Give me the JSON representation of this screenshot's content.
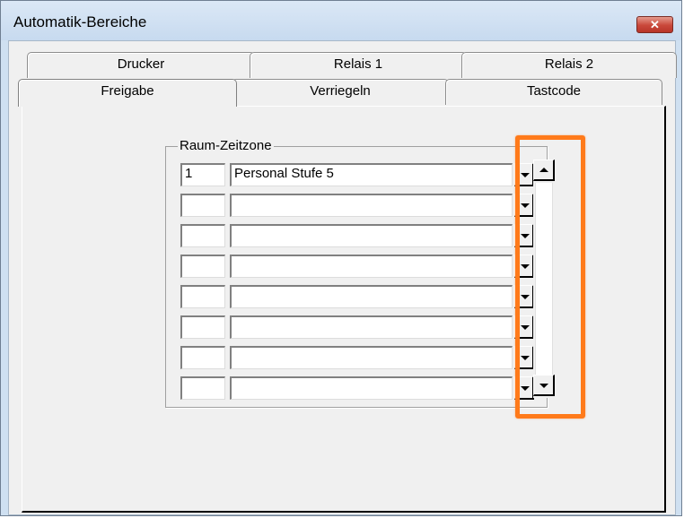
{
  "window": {
    "title": "Automatik-Bereiche",
    "close_symbol": "✕"
  },
  "tabs_back": [
    {
      "label": "Drucker"
    },
    {
      "label": "Relais 1"
    },
    {
      "label": "Relais 2"
    }
  ],
  "tabs_front": [
    {
      "label": "Freigabe",
      "selected": true
    },
    {
      "label": "Verriegeln"
    },
    {
      "label": "Tastcode"
    }
  ],
  "group": {
    "label": "Raum-Zeitzone",
    "rows": [
      {
        "num": "1",
        "name": "Personal Stufe 5"
      },
      {
        "num": "",
        "name": ""
      },
      {
        "num": "",
        "name": ""
      },
      {
        "num": "",
        "name": ""
      },
      {
        "num": "",
        "name": ""
      },
      {
        "num": "",
        "name": ""
      },
      {
        "num": "",
        "name": ""
      },
      {
        "num": "",
        "name": ""
      }
    ]
  },
  "icons": {
    "close": "close-icon",
    "dropdown": "chevron-down-icon",
    "scroll_up": "scroll-up-icon",
    "scroll_down": "scroll-down-icon"
  },
  "colors": {
    "highlight": "#ff7a1a",
    "close_button": "#c9483a",
    "titlebar": "#cfe0f1"
  }
}
